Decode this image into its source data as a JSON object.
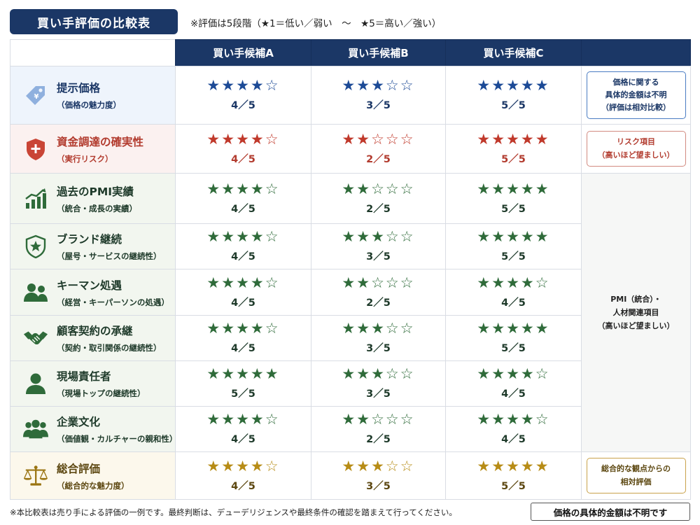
{
  "title": "買い手評価の比較表",
  "rating_note": "※評価は5段階（★1＝低い／弱い　～　★5＝高い／強い）",
  "columns": [
    "買い手候補A",
    "買い手候補B",
    "買い手候補C"
  ],
  "rows": [
    {
      "title": "提示価格",
      "sub": "（価格の魅力度）",
      "icon": "price-tag-icon",
      "scores": [
        {
          "stars": "★★★★☆",
          "text": "4／5"
        },
        {
          "stars": "★★★☆☆",
          "text": "3／5"
        },
        {
          "stars": "★★★★★",
          "text": "5／5"
        }
      ]
    },
    {
      "title": "資金調達の確実性",
      "sub": "（実行リスク）",
      "icon": "shield-plus-icon",
      "scores": [
        {
          "stars": "★★★★☆",
          "text": "4／5"
        },
        {
          "stars": "★★☆☆☆",
          "text": "2／5"
        },
        {
          "stars": "★★★★★",
          "text": "5／5"
        }
      ]
    },
    {
      "title": "過去のPMI実績",
      "sub": "（統合・成長の実績）",
      "icon": "growth-chart-icon",
      "scores": [
        {
          "stars": "★★★★☆",
          "text": "4／5"
        },
        {
          "stars": "★★☆☆☆",
          "text": "2／5"
        },
        {
          "stars": "★★★★★",
          "text": "5／5"
        }
      ]
    },
    {
      "title": "ブランド継続",
      "sub": "（屋号・サービスの継続性）",
      "icon": "shield-star-icon",
      "scores": [
        {
          "stars": "★★★★☆",
          "text": "4／5"
        },
        {
          "stars": "★★★☆☆",
          "text": "3／5"
        },
        {
          "stars": "★★★★★",
          "text": "5／5"
        }
      ]
    },
    {
      "title": "キーマン処遇",
      "sub": "（経営・キーパーソンの処遇）",
      "icon": "people-icon",
      "scores": [
        {
          "stars": "★★★★☆",
          "text": "4／5"
        },
        {
          "stars": "★★☆☆☆",
          "text": "2／5"
        },
        {
          "stars": "★★★★☆",
          "text": "4／5"
        }
      ]
    },
    {
      "title": "顧客契約の承継",
      "sub": "（契約・取引関係の継続性）",
      "icon": "handshake-icon",
      "scores": [
        {
          "stars": "★★★★☆",
          "text": "4／5"
        },
        {
          "stars": "★★★☆☆",
          "text": "3／5"
        },
        {
          "stars": "★★★★★",
          "text": "5／5"
        }
      ]
    },
    {
      "title": "現場責任者",
      "sub": "（現場トップの継続性）",
      "icon": "person-icon",
      "scores": [
        {
          "stars": "★★★★★",
          "text": "5／5"
        },
        {
          "stars": "★★★☆☆",
          "text": "3／5"
        },
        {
          "stars": "★★★★☆",
          "text": "4／5"
        }
      ]
    },
    {
      "title": "企業文化",
      "sub": "（価値観・カルチャーの親和性）",
      "icon": "group-icon",
      "scores": [
        {
          "stars": "★★★★☆",
          "text": "4／5"
        },
        {
          "stars": "★★☆☆☆",
          "text": "2／5"
        },
        {
          "stars": "★★★★☆",
          "text": "4／5"
        }
      ]
    },
    {
      "title": "総合評価",
      "sub": "（総合的な魅力度）",
      "icon": "scales-icon",
      "scores": [
        {
          "stars": "★★★★☆",
          "text": "4／5"
        },
        {
          "stars": "★★★☆☆",
          "text": "3／5"
        },
        {
          "stars": "★★★★★",
          "text": "5／5"
        }
      ]
    }
  ],
  "notes": {
    "price": "価格に関する\n具体的金額は不明\n（評価は相対比較）",
    "risk": "リスク項目\n（高いほど望ましい）",
    "pmi": "PMI（統合）・\n人材関連項目\n（高いほど望ましい）",
    "overall": "総合的な観点からの\n相対評価"
  },
  "footnote": "※本比較表は売り手による評価の一例です。最終判断は、デューデリジェンスや最終条件の確認を踏まえて行ってください。",
  "footer_box": "価格の具体的金額は不明です",
  "colors": {
    "navy": "#1b3766",
    "star_blue": "#1c4a96",
    "star_red": "#c0392b",
    "star_green": "#2f6b3a",
    "star_gold": "#b78c16"
  }
}
